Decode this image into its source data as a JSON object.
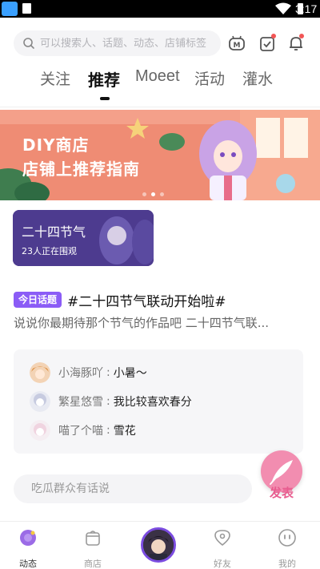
{
  "status_bar": {
    "time": "3:17"
  },
  "search": {
    "placeholder": "可以搜索人、话题、动态、店铺标签"
  },
  "tabs": [
    {
      "label": "关注",
      "active": false
    },
    {
      "label": "推荐",
      "active": true
    },
    {
      "label": "Moeet",
      "active": false
    },
    {
      "label": "活动",
      "active": false
    },
    {
      "label": "灌水",
      "active": false
    }
  ],
  "banner": {
    "line1": "DIY商店",
    "line2": "店铺上推荐指南",
    "slide_index": 1,
    "slide_count": 3
  },
  "term_card": {
    "title": "二十四节气",
    "viewers": "23人正在围观"
  },
  "topic": {
    "badge": "今日话题",
    "title": "#二十四节气联动开始啦#",
    "description": "说说你最期待那个节气的作品吧 二十四节气联..."
  },
  "comments": [
    {
      "user": "小海豚吖",
      "colon": ":",
      "text": "小暑～"
    },
    {
      "user": "繁星悠雪",
      "colon": ":",
      "text": "我比较喜欢春分"
    },
    {
      "user": "喵了个喵",
      "colon": ":",
      "text": "雪花"
    }
  ],
  "reply": {
    "placeholder": "吃瓜群众有话说"
  },
  "fab": {
    "label": "发表"
  },
  "bottom_nav": [
    {
      "label": "动态",
      "active": true
    },
    {
      "label": "商店",
      "active": false
    },
    {
      "label": "好友",
      "active": false
    },
    {
      "label": "我的",
      "active": false
    }
  ],
  "colors": {
    "accent": "#8b5cf6",
    "banner": "#f08a72",
    "fab": "#f28db0",
    "term_card": "#4a3a8a"
  }
}
